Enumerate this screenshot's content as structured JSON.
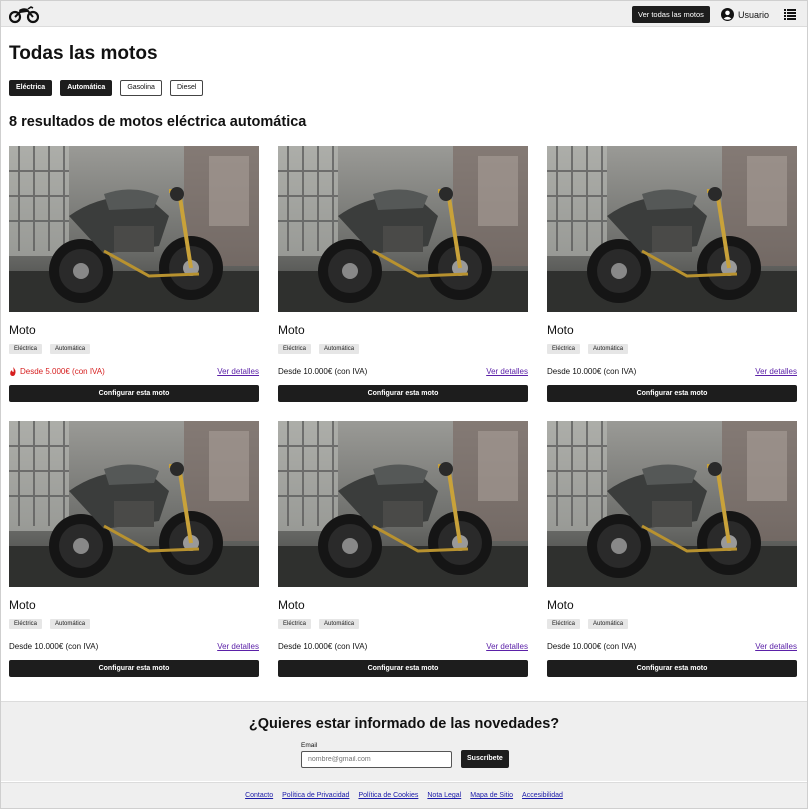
{
  "header": {
    "logo_icon": "motorcycle-icon",
    "all_bikes_label": "Ver todas las motos",
    "user_label": "Usuario",
    "user_icon": "user-circle-icon",
    "menu_icon": "list-menu-icon"
  },
  "page": {
    "title": "Todas las motos",
    "filters": [
      {
        "label": "Eléctrica",
        "active": true
      },
      {
        "label": "Automática",
        "active": true
      },
      {
        "label": "Gasolina",
        "active": false
      },
      {
        "label": "Diesel",
        "active": false
      }
    ],
    "results_text": "8 resultados de motos eléctrica automática"
  },
  "cards": [
    {
      "name": "Moto",
      "tags": [
        "Eléctrica",
        "Automática"
      ],
      "price": "Desde 5.000€ (con IVA)",
      "offer": true,
      "details_label": "Ver detalles",
      "config_label": "Configurar esta moto"
    },
    {
      "name": "Moto",
      "tags": [
        "Eléctrica",
        "Automática"
      ],
      "price": "Desde 10.000€ (con IVA)",
      "offer": false,
      "details_label": "Ver detalles",
      "config_label": "Configurar esta moto"
    },
    {
      "name": "Moto",
      "tags": [
        "Eléctrica",
        "Automática"
      ],
      "price": "Desde 10.000€ (con IVA)",
      "offer": false,
      "details_label": "Ver detalles",
      "config_label": "Configurar esta moto"
    },
    {
      "name": "Moto",
      "tags": [
        "Eléctrica",
        "Automática"
      ],
      "price": "Desde 10.000€ (con IVA)",
      "offer": false,
      "details_label": "Ver detalles",
      "config_label": "Configurar esta moto"
    },
    {
      "name": "Moto",
      "tags": [
        "Eléctrica",
        "Automática"
      ],
      "price": "Desde 10.000€ (con IVA)",
      "offer": false,
      "details_label": "Ver detalles",
      "config_label": "Configurar esta moto"
    },
    {
      "name": "Moto",
      "tags": [
        "Eléctrica",
        "Automática"
      ],
      "price": "Desde 10.000€ (con IVA)",
      "offer": false,
      "details_label": "Ver detalles",
      "config_label": "Configurar esta moto"
    }
  ],
  "newsletter": {
    "title": "¿Quieres estar informado de las novedades?",
    "email_label": "Email",
    "email_placeholder": "nombre@gmail.com",
    "subscribe_label": "Suscríbete"
  },
  "footer": {
    "links": [
      "Contacto",
      "Política de Privacidad",
      "Política de Cookies",
      "Nota Legal",
      "Mapa de Sitio",
      "Accesibilidad"
    ]
  },
  "colors": {
    "dark_button": "#1d1d1d",
    "offer_price": "#d61f1f",
    "link_visited": "#5b21a8",
    "footer_link": "#1a1aa8"
  }
}
